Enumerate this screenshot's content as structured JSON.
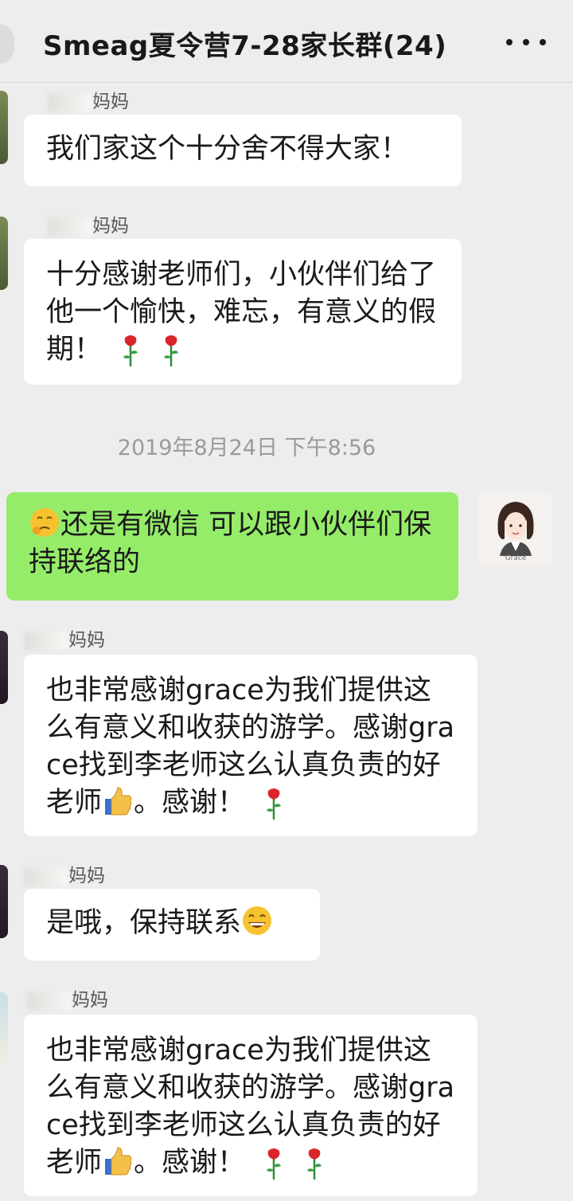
{
  "header": {
    "title": "Smeag夏令营7-28家长群(24)"
  },
  "messages": [
    {
      "sender": "妈妈",
      "text": "我们家这个十分舍不得大家！"
    },
    {
      "sender": "妈妈",
      "text": "十分感谢老师们，小伙伴们给了他一个愉快，难忘，有意义的假期！"
    },
    {
      "timestamp": "2019年8月24日 下午8:56"
    },
    {
      "text": "还是有微信 可以跟小伙伴们保持联络的",
      "self_avatar_label": "Grace"
    },
    {
      "sender": "妈妈",
      "text_a": "也非常感谢grace为我们提供这么有意义和收获的游学。感谢grace找到李老师这么认真负责的好老师",
      "text_b": "。感谢！"
    },
    {
      "sender": "妈妈",
      "text": "是哦，保持联系"
    },
    {
      "sender": "妈妈",
      "text_a": "也非常感谢grace为我们提供这么有意义和收获的游学。感谢grace找到李老师这么认真负责的好老师",
      "text_b": "。感谢！"
    }
  ],
  "colors": {
    "background": "#ededed",
    "bubble_incoming": "#ffffff",
    "bubble_outgoing": "#95ec69"
  }
}
